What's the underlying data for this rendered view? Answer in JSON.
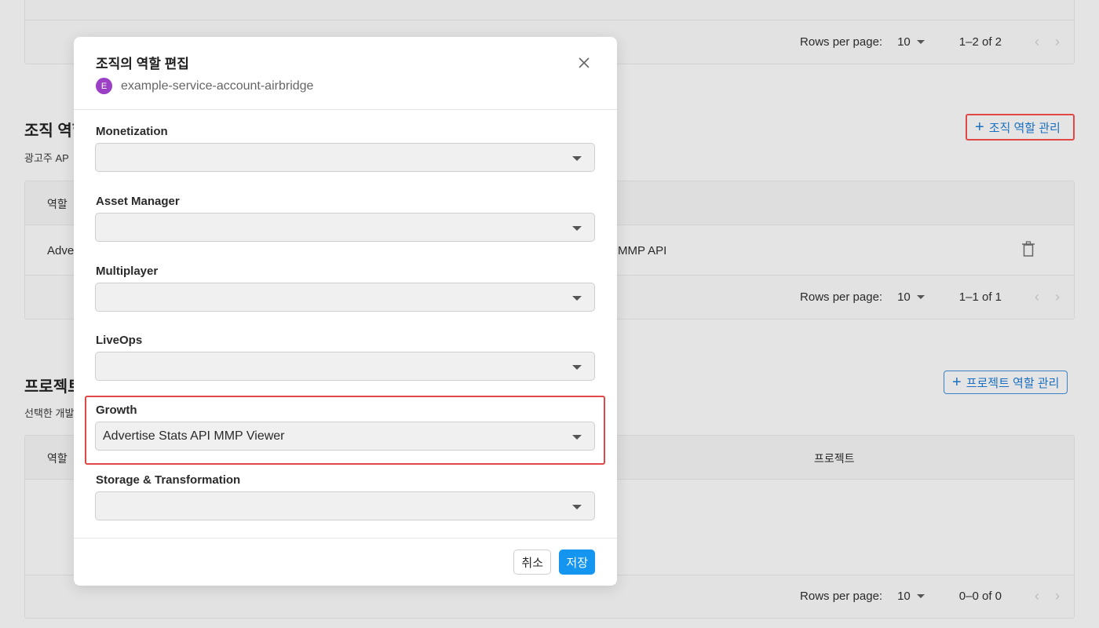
{
  "top_table": {
    "rows_per_page_label": "Rows per page:",
    "rows_per_page": "10",
    "range": "1–2 of 2",
    "prev": "‹",
    "next": "›"
  },
  "org_section": {
    "title_partial": "조직 역할",
    "desc_partial": "광고주 AP",
    "manage_button": "조직 역할 관리",
    "table": {
      "header_role": "역할",
      "row_role_partial": "Adve",
      "row_desc_partial": "MMP API",
      "rows_per_page_label": "Rows per page:",
      "rows_per_page": "10",
      "range": "1–1 of 1"
    }
  },
  "project_section": {
    "title_partial": "프로젝트",
    "desc_partial": "선택한 개발",
    "manage_button": "프로젝트 역할 관리",
    "table": {
      "header_role": "역할",
      "header_project": "프로젝트",
      "rows_per_page_label": "Rows per page:",
      "rows_per_page": "10",
      "range": "0–0 of 0"
    }
  },
  "modal": {
    "title": "조직의 역할 편집",
    "avatar_letter": "E",
    "account_name": "example-service-account-airbridge",
    "fields": [
      {
        "label": "Monetization",
        "value": ""
      },
      {
        "label": "Asset Manager",
        "value": ""
      },
      {
        "label": "Multiplayer",
        "value": ""
      },
      {
        "label": "LiveOps",
        "value": ""
      },
      {
        "label": "Growth",
        "value": "Advertise Stats API MMP Viewer"
      },
      {
        "label": "Storage & Transformation",
        "value": ""
      }
    ],
    "cancel_button": "취소",
    "save_button": "저장"
  },
  "colors": {
    "primary": "#1496f0",
    "highlight": "#e04848",
    "avatar": "#9b3fc4",
    "link": "#1a6fc0"
  }
}
